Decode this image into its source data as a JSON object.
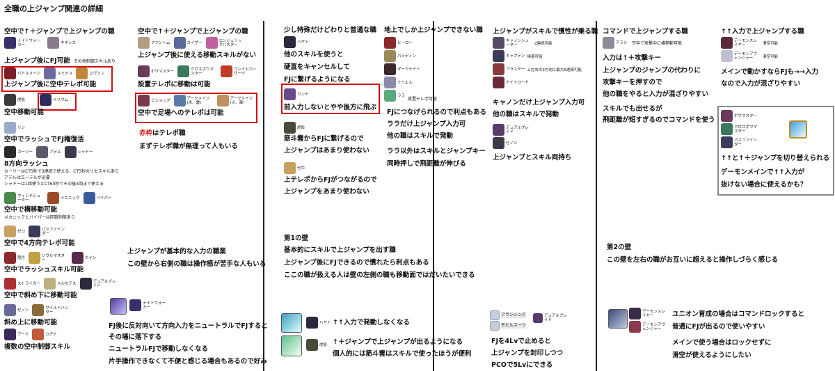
{
  "title": "全職の上ジャンプ関連の詳細",
  "col1": {
    "s1_head": "空中で↑＋ジャンプで上ジャンプの職",
    "s1_chars": [
      {
        "name": "ナイトウォーカー",
        "color": "#3a2f6b",
        "note": "その他制御スキルあり"
      },
      {
        "name": "キネシス",
        "color": "#8a7a8c"
      }
    ],
    "s1_text": "上ジャンプ後にFJ可能",
    "s1_note": "その他制御スキルあり",
    "s2_chars": [
      {
        "name": "バトルメイジ",
        "color": "#7a1f2a"
      },
      {
        "name": "ルミナス",
        "color": "#6c6a9e"
      },
      {
        "name": "エヴァン",
        "color": "#c4863a"
      }
    ],
    "s2_text": "上ジャンプ後に空中テレポ可能",
    "s3_chars": [
      {
        "name": "イリウム",
        "color": "#2c2c5c"
      }
    ],
    "s3_pre": [
      {
        "name": "虎影",
        "color": "#3a3a3a"
      }
    ],
    "s3_text": "空中移動可能",
    "s4_chars": [
      {
        "name": "リン",
        "color": "#9aaccc"
      }
    ],
    "s4_text": "空中でラッシュでFJ権復活",
    "s5_chars": [
      {
        "name": "カーリー",
        "color": "#2a2a2a"
      },
      {
        "name": "アデル",
        "color": "#5a5a6a"
      },
      {
        "name": "シャドー",
        "color": "#3a3a4a"
      }
    ],
    "s5_text": "8方向ラッシュ",
    "s5_n1": "カーリーはCT5秒で3連続で使える、CT5秒のリセスキルあり",
    "s5_n2": "アデルはエーテルが必要",
    "s5_n3": "シャドーは1回使うとCT60秒でその後3回まで使える",
    "s6_chars": [
      {
        "name": "ウィンドシューター",
        "color": "#4a8a4a"
      },
      {
        "name": "メカニック",
        "color": "#9a4a2a"
      },
      {
        "name": "バイパー",
        "color": "#3a5a9a"
      }
    ],
    "s6_text": "空中で横移動可能",
    "s6_note": "メカニックとバイパーは回数制限あり",
    "s7_chars": [
      {
        "name": "ゼロ",
        "color": "#c8a060"
      },
      {
        "name": "パスファインダー",
        "color": "#3a3a5a"
      }
    ],
    "s7_text": "空中で4方向テレポ可能",
    "s8_chars": [
      {
        "name": "隠月",
        "color": "#8a2a2a"
      },
      {
        "name": "ソウルマスター",
        "color": "#c0a040"
      },
      {
        "name": "カイン",
        "color": "#5a2a4a"
      }
    ],
    "s8_text": "空中でラッシュスキル可能",
    "s9_chars": [
      {
        "name": "ストライカー",
        "color": "#b03030"
      },
      {
        "name": "メルセデス",
        "color": "#c0b080"
      },
      {
        "name": "デュアルブレイド",
        "color": "#2a2a3a"
      }
    ],
    "s9_text": "空中で斜め下に移動可能",
    "s10_chars": [
      {
        "name": "ゼノン",
        "color": "#6a6a9a"
      },
      {
        "name": "ワイルドハンター",
        "color": "#8a6a3a"
      }
    ],
    "s10_text": "斜め上に移動可能",
    "s11_chars": [
      {
        "name": "アーク",
        "color": "#3a2a5a"
      },
      {
        "name": "カデナ",
        "color": "#c05a3a"
      }
    ],
    "s11_text": "複数の空中制御スキル"
  },
  "col2": {
    "s1_head": "空中で↑＋ジャンプで上ジャンプの職",
    "s1_chars": [
      {
        "name": "ファントム",
        "color": "#b0a080"
      },
      {
        "name": "カイザー",
        "color": "#5a6a9a"
      },
      {
        "name": "エンジェリックバスター",
        "color": "#c060a0"
      }
    ],
    "s1_text": "上ジャンプ後に使える移動スキルがない",
    "s2_chars": [
      {
        "name": "ボウマスター",
        "color": "#6a3a5a"
      },
      {
        "name": "クロスボウマスター",
        "color": "#3a7a5a"
      },
      {
        "name": "フレイムウィザード",
        "color": "#c03a2a"
      }
    ],
    "s2_text": "設置テレポに移動は可能",
    "s3_chars": [
      {
        "name": "ビショップ",
        "color": "#7a3a4a"
      },
      {
        "name": "アークメイジ(氷、雷)",
        "color": "#5a7aaa"
      },
      {
        "name": "アークメイジ(火、毒)",
        "color": "#c09060"
      }
    ],
    "s3_text": "空中で足場へのテレポは可能",
    "s4_red": "赤枠",
    "s4_rest": "はテレポ職",
    "s4_text2": "まずテレポ職が無理って人もいる",
    "s5_l1": "上ジャンプが基本的な入力の職業",
    "s5_l2": "この壁から右側の職は操作感が苦手な人もいる",
    "s6_chars": [
      {
        "name": "ナイトウォーカー",
        "color": "#3a2f6b"
      }
    ],
    "s6_l1": "FJ後に反対向いて方向入力をニュートラルでFJすると",
    "s6_l2": "その場に落下する",
    "s6_l3": "ニュートラルFJで移動しなくなる",
    "s6_l4": "片手操作できなくて不便と感じる場合もあるので好み"
  },
  "col3": {
    "s1_head": "少し特殊だけどわりと普通な職",
    "s1_chars": [
      {
        "name": "ハヤト",
        "color": "#2a2a3a"
      }
    ],
    "s1_note": "その後空中制御スキルあり",
    "s1_l1": "他のスキルを使うと",
    "s1_l2": "硬直をキャンセルして",
    "s1_l3": "FJに繋げるようになる",
    "s2_chars": [
      {
        "name": "カンナ",
        "color": "#6a4a8a"
      }
    ],
    "s2_text": "前入力しないとやや後方に飛ぶ",
    "s3_chars": [
      {
        "name": "虎影",
        "color": "#4a4a3a"
      }
    ],
    "s3_l1": "筋斗雲からFJに繋げるので",
    "s3_l2": "上ジャンプはあまり使わない",
    "s4_chars": [
      {
        "name": "ゼロ",
        "color": "#c8a060"
      }
    ],
    "s4_l1": "上テレポからFJがつながるので",
    "s4_l2": "上ジャンプをあまり使わない",
    "wall1_l1": "第1の壁",
    "wall1_l2": "基本的にスキルで上ジャンプを出す職",
    "wall1_l3": "上ジャンプ後にFJできるので慣れたら利点もある",
    "wall1_l4": "ここの職が扱える人は壁の左側の職も移動面ではだいたいできる",
    "s5_chars": [
      {
        "name": "ハヤト",
        "color": "#2a2a3a"
      }
    ],
    "s5_text": "↑↑入力で発動しなくなる",
    "s6_chars": [
      {
        "name": "虎影",
        "color": "#4a4a3a"
      }
    ],
    "s6_l1": "↑＋ジャンプで上ジャンプが出るようになる",
    "s6_l2": "個人的には筋斗雲はスキルで使ったほうが便利"
  },
  "col4": {
    "s1_head": "地上でしか上ジャンプできない職",
    "s1_chars": [
      {
        "name": "ヒーロー",
        "color": "#8a2a2a"
      },
      {
        "name": "パラディン",
        "color": "#9a8a5a"
      },
      {
        "name": "ダークナイト",
        "color": "#3a2a2a"
      },
      {
        "name": "ミハエル",
        "color": "#8a8aaa"
      },
      {
        "name": "ララ",
        "color": "#5aaa7a"
      }
    ],
    "s1_note": "設置テレポ可能",
    "s1_l1": "FJにつなげられるので利点もある",
    "s1_l2": "ララだけ上ジャンプ入力可",
    "s1_l3": "他の職はスキルで発動",
    "s1_l4": "ララ以外はスキルとジャンプキー",
    "s1_l5": "同時押しで飛距離が伸びる",
    "s2_chars": [
      {
        "name": "アランシンク",
        "color": "#d0d0d0"
      },
      {
        "name": "モビルスーツ",
        "color": "#d0d0d0"
      }
    ],
    "s2_dual": "デュアルブレイド",
    "s2_l1": "FJを4Lvで止めると",
    "s2_l2": "上ジャンプを封印しつつ",
    "s2_l3": "PCOで5Lvにできる"
  },
  "col5": {
    "s1_head": "上ジャンプがスキルで慣性が乗る職",
    "s1_chars": [
      {
        "name": "キャノンシューター",
        "color": "#5a4a6a",
        "note": "2連続可能"
      },
      {
        "name": "キャプテン",
        "color": "#3a3a5a",
        "note": "帰還可能"
      },
      {
        "name": "ブラスター",
        "color": "#8a3a3a",
        "note": "上左右の3方向に最大6連続可能"
      },
      {
        "name": "ナイトロード",
        "color": "#6a2a3a"
      }
    ],
    "s1_l1": "キャノンだけ上ジャンプ入力可",
    "s1_l2": "他の職はスキルで発動",
    "s2_chars": [
      {
        "name": "デュアルブレイド",
        "color": "#5a3a6a"
      },
      {
        "name": "ゼノン",
        "color": "#3a3a4a"
      }
    ],
    "s2_text": "上ジャンプとスキル両持ち"
  },
  "col6": {
    "s1_head": "コマンドで上ジャンプする職",
    "s1_chars": [
      {
        "name": "アラン",
        "color": "#8a8a9a"
      }
    ],
    "s1_note": "空中で攻撃中に横移動可能",
    "s1_l1": "入力は↑＋攻撃キー",
    "s1_l2": "上ジャンプのジャンプの代わりに",
    "s1_l3": "攻撃キーを押すので",
    "s1_l4": "他の職をやると入力が混ざりやすい",
    "s1_l5": "スキルでも出せるが",
    "s1_l6": "飛距離が短すぎるのでコマンドを使う",
    "wall2_l1": "第2の壁",
    "wall2_l2": "この壁を左右の職がお互いに超えると操作しづらく感じる",
    "s2_chars": [
      {
        "name": "デーモンスレイヤー",
        "color": "#3a2a4a"
      },
      {
        "name": "デーモンアヴェンジャー",
        "color": "#8a3a4a"
      }
    ],
    "s2_l1": "ユニオン育成の場合はコマンドロックすると",
    "s2_l2": "普通にFJが出るので使いやすい",
    "s2_l3": "メインで使う場合はロックせずに",
    "s2_l4": "滑空が使えるようにしたい"
  },
  "col7": {
    "s1_head": "↑↑入力で上ジャンプする職",
    "s1_chars": [
      {
        "name": "デーモンスレイヤー",
        "color": "#5a2a3a",
        "note": "滑空可能"
      },
      {
        "name": "デーモンアヴェンジャー",
        "color": "#c0c0d0",
        "note": "滑空可能"
      }
    ],
    "s1_l1": "メインで動かすならFJも→→入力",
    "s1_l2": "なので入力が混ざりやすい",
    "s2_chars": [
      {
        "name": "ボウマスター",
        "color": "#6a3a5a"
      },
      {
        "name": "クロスボウマスター",
        "color": "#3a7a5a"
      },
      {
        "name": "パスファインダー",
        "color": "#3a3a5a"
      }
    ],
    "s2_l1": "↑↑と↑＋ジャンプを切り替えられる",
    "s2_l2": "デーモンメインで↑↑入力が",
    "s2_l3": "抜けない場合に使えるかも？"
  },
  "colors": {
    "red": "#d01010",
    "gray": "#888888",
    "line": "#222222"
  }
}
